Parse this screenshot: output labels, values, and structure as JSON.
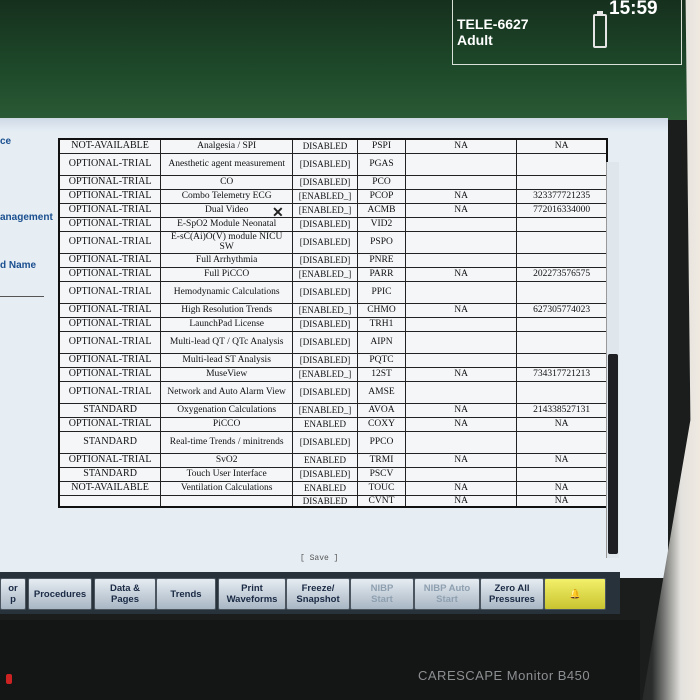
{
  "header": {
    "monitor_id": "TELE-6627",
    "patient_type": "Adult",
    "time": "15:59"
  },
  "side_labels": [
    "ce",
    "anagement",
    "d Name"
  ],
  "rows": [
    [
      "NOT-AVAILABLE",
      "Analgesia / SPI",
      "DISABLED",
      "PSPI",
      "NA",
      "NA"
    ],
    [
      "OPTIONAL-TRIAL",
      "Anesthetic agent measurement",
      "[DISABLED]",
      "PGAS",
      "",
      ""
    ],
    [
      "OPTIONAL-TRIAL",
      "CO",
      "[DISABLED]",
      "PCO",
      "",
      ""
    ],
    [
      "OPTIONAL-TRIAL",
      "Combo Telemetry ECG",
      "[ENABLED_]",
      "PCOP",
      "NA",
      "323377721235"
    ],
    [
      "OPTIONAL-TRIAL",
      "Dual Video",
      "[ENABLED_]",
      "ACMB",
      "NA",
      "772016334000"
    ],
    [
      "OPTIONAL-TRIAL",
      "E-SpO2 Module Neonatal",
      "[DISABLED]",
      "VID2",
      "",
      ""
    ],
    [
      "OPTIONAL-TRIAL",
      "E-sC(Ai)O(V) module NICU SW",
      "[DISABLED]",
      "PSPO",
      "",
      ""
    ],
    [
      "OPTIONAL-TRIAL",
      "Full Arrhythmia",
      "[DISABLED]",
      "PNRE",
      "",
      ""
    ],
    [
      "OPTIONAL-TRIAL",
      "Full PiCCO",
      "[ENABLED_]",
      "PARR",
      "NA",
      "202273576575"
    ],
    [
      "OPTIONAL-TRIAL",
      "Hemodynamic Calculations",
      "[DISABLED]",
      "PPIC",
      "",
      ""
    ],
    [
      "OPTIONAL-TRIAL",
      "High Resolution Trends",
      "[ENABLED_]",
      "CHMO",
      "NA",
      "627305774023"
    ],
    [
      "OPTIONAL-TRIAL",
      "LaunchPad License",
      "[DISABLED]",
      "TRH1",
      "",
      ""
    ],
    [
      "OPTIONAL-TRIAL",
      "Multi-lead QT / QTc Analysis",
      "[DISABLED]",
      "AIPN",
      "",
      ""
    ],
    [
      "OPTIONAL-TRIAL",
      "Multi-lead ST Analysis",
      "[DISABLED]",
      "PQTC",
      "",
      ""
    ],
    [
      "OPTIONAL-TRIAL",
      "MuseView",
      "[ENABLED_]",
      "12ST",
      "NA",
      "734317721213"
    ],
    [
      "OPTIONAL-TRIAL",
      "Network and Auto Alarm View",
      "[DISABLED]",
      "AMSE",
      "",
      ""
    ],
    [
      "STANDARD",
      "Oxygenation Calculations",
      "[ENABLED_]",
      "AVOA",
      "NA",
      "214338527131"
    ],
    [
      "OPTIONAL-TRIAL",
      "PiCCO",
      "ENABLED",
      "COXY",
      "NA",
      "NA"
    ],
    [
      "STANDARD",
      "Real-time Trends / minitrends",
      "[DISABLED]",
      "PPCO",
      "",
      ""
    ],
    [
      "OPTIONAL-TRIAL",
      "SvO2",
      "ENABLED",
      "TRMI",
      "NA",
      "NA"
    ],
    [
      "STANDARD",
      "Touch User Interface",
      "[DISABLED]",
      "PSCV",
      "",
      ""
    ],
    [
      "NOT-AVAILABLE",
      "Ventilation Calculations",
      "ENABLED",
      "TOUC",
      "NA",
      "NA"
    ],
    [
      "",
      "",
      "DISABLED",
      "CVNT",
      "NA",
      "NA"
    ]
  ],
  "save_label": "[ Save ]",
  "toolbar": [
    {
      "label": "or\np",
      "dim": false
    },
    {
      "label": "Procedures",
      "dim": false
    },
    {
      "label": "Data &\nPages",
      "dim": false
    },
    {
      "label": "Trends",
      "dim": false
    },
    {
      "label": "Print\nWaveforms",
      "dim": false
    },
    {
      "label": "Freeze/\nSnapshot",
      "dim": false
    },
    {
      "label": "NIBP\nStart",
      "dim": true
    },
    {
      "label": "NIBP Auto\nStart",
      "dim": true
    },
    {
      "label": "Zero All\nPressures",
      "dim": false
    }
  ],
  "brand": "CARESCAPE Monitor B450"
}
